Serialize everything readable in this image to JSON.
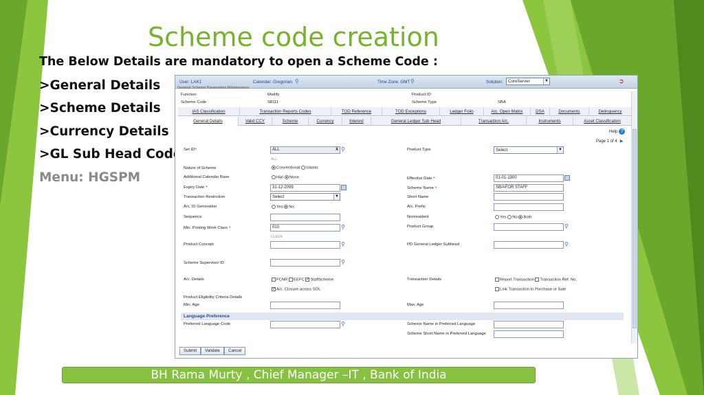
{
  "slide": {
    "title": "Scheme code creation",
    "intro": "The Below Details are mandatory to open a Scheme Code :",
    "bullets": [
      ">General Details",
      ">Scheme Details",
      ">Currency Details",
      ">GL Sub Head Codes"
    ],
    "menu": "Menu: HGSPM",
    "footer": "BH Rama Murty , Chief Manager –IT , Bank of India"
  },
  "colors": {
    "accent": "#77b22c",
    "footer_bg": "#86c142",
    "app_header": "#c5d3e8"
  },
  "app": {
    "topbar": {
      "user": "User: LAK1",
      "calendar": "Calendar: Gregorian",
      "timezone": "Time Zone: GMT",
      "solution_label": "Solution:",
      "solution_value": "CoreServer",
      "exit_icon": "exit-icon"
    },
    "header_cut": "General Scheme Parameters Maintenance",
    "info": {
      "function_label": "Function",
      "function_value": "Modify",
      "scheme_code_label": "Scheme Code",
      "scheme_code_value": "S8111",
      "product_id_label": "Product ID",
      "product_id_value": "",
      "scheme_type_label": "Scheme Type",
      "scheme_type_value": "SBA"
    },
    "tabs_row1": [
      "IAS Classification",
      "Transaction Reports Codes",
      "TOD Reference",
      "TOD Exceptions",
      "Ledger Folio",
      "A/c. Open Matrix",
      "DSA",
      "Documents",
      "Delinquency"
    ],
    "tabs_row2": [
      "General Details",
      "Valid CCY",
      "Scheme",
      "Currency",
      "Interest",
      "General Ledger Sub Head",
      "Transaction A/c.",
      "Instruments",
      "Asset Classification"
    ],
    "help_label": "Help",
    "page_label": "Page 1 of 4",
    "fields": {
      "set_id": "Set ID",
      "set_id_value": "ALL",
      "set_id_hint": "ALL",
      "product_type": "Product Type",
      "product_type_value": "Select",
      "nature_of_scheme": "Nature of Scheme",
      "conventional": "Conventional",
      "islamic": "Islamic",
      "additional_calendar_base": "Additional Calendar Base",
      "hijri": "Hijri",
      "none": "None",
      "effective_date": "Effective Date",
      "effective_date_value": "01-01-1900",
      "expiry_date": "Expiry Date",
      "expiry_date_value": "31-12-2099",
      "scheme_name": "Scheme Name",
      "scheme_name_value": "SB/AFOR STAFF",
      "transaction_restriction": "Transaction Restriction",
      "transaction_restriction_value": "Select",
      "short_name": "Short Name",
      "ac_id_generation": "A/c. ID Generation",
      "yes": "Yes",
      "no": "No",
      "ac_prefix": "A/c. Prefix",
      "sequence": "Sequence",
      "nonresident": "Nonresident",
      "both": "Both",
      "min_posting_work_class": "Min. Posting Work Class",
      "min_posting_work_class_value": "010",
      "min_posting_hint": "CLERK",
      "product_group": "Product Group",
      "product_concept": "Product Concept",
      "pd_gl_subhead": "PD General Ledger Subhead",
      "scheme_supervisor_id": "Scheme Supervisor ID",
      "ac_details": "A/c. Details",
      "fcnr": "FCNR",
      "eefc": "EEFC",
      "staff_scheme": "StaffScheme",
      "ac_closure": "A/c. Closure across SOL",
      "transaction_details": "Transaction Details",
      "report_transaction": "Report Transaction",
      "transaction_ref_no": "Transaction Ref. No.",
      "link_transaction": "Link Transaction to Purchase or Sale",
      "product_eligibility": "Product Eligibility Criteria Details",
      "min_age": "Min. Age",
      "max_age": "Max. Age",
      "language_preference": "Language Preference",
      "preferred_language_code": "Preferred Language Code",
      "scheme_name_pref_lang": "Scheme Name in Preferred Language",
      "scheme_short_name_pref_lang": "Scheme Short Name in Preferred Language"
    },
    "buttons": {
      "submit": "Submit",
      "validate": "Validate",
      "cancel": "Cancel"
    }
  }
}
